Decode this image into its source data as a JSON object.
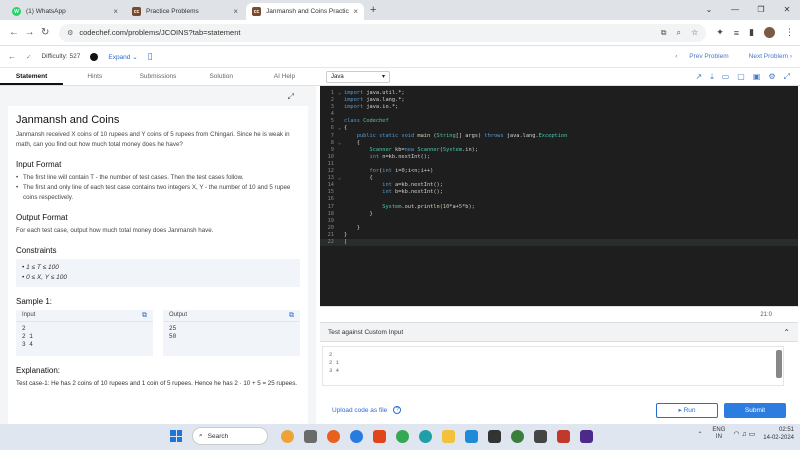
{
  "browser": {
    "tabs": [
      {
        "title": "(1) WhatsApp",
        "color": "#25d366",
        "glyph": "W"
      },
      {
        "title": "Practice Problems",
        "color": "#7a4a2f",
        "glyph": "cc"
      },
      {
        "title": "Janmansh and Coins Practice C...",
        "color": "#7a4a2f",
        "glyph": "cc"
      }
    ],
    "url": "codechef.com/problems/JCOINS?tab=statement"
  },
  "problem_bar": {
    "difficulty": "Difficulty: 527",
    "expand": "Expand",
    "prev": "Prev Problem",
    "next": "Next Problem"
  },
  "left_tabs": [
    "Statement",
    "Hints",
    "Submissions",
    "Solution",
    "AI Help"
  ],
  "statement": {
    "title": "Janmansh and Coins",
    "intro": "Janmansh received X coins of 10 rupees and Y coins of 5 rupees from Chingari. Since he is weak in math, can you find out how much total money does he have?",
    "input_heading": "Input Format",
    "input_bullets": [
      "The first line will contain T - the number of test cases. Then the test cases follow.",
      "The first and only line of each test case contains two integers X, Y - the number of 10 and 5 rupee coins respectively."
    ],
    "output_heading": "Output Format",
    "output_text": "For each test case, output how much total money does Janmansh have.",
    "constraints_heading": "Constraints",
    "constraints": [
      "1 ≤ T ≤ 100",
      "0 ≤ X, Y ≤ 100"
    ],
    "sample_heading": "Sample 1:",
    "sample_input_label": "Input",
    "sample_output_label": "Output",
    "sample_input": "2\n2 1\n3 4",
    "sample_output": "25\n50",
    "explanation_heading": "Explanation:",
    "explanation": "Test case-1: He has 2 coins of 10 rupees and 1 coin of 5 rupees. Hence he has 2 · 10 + 5 = 25 rupees."
  },
  "editor": {
    "language": "Java",
    "cursor_pos": "21:0"
  },
  "custom_input": {
    "heading": "Test against Custom Input",
    "value": "2\n2 1\n3 4"
  },
  "actions": {
    "upload": "Upload code as file",
    "run": "Run",
    "submit": "Submit"
  },
  "taskbar": {
    "search": "Search",
    "lang_line1": "ENG",
    "lang_line2": "IN",
    "time": "02:51",
    "date": "14-02-2024"
  }
}
